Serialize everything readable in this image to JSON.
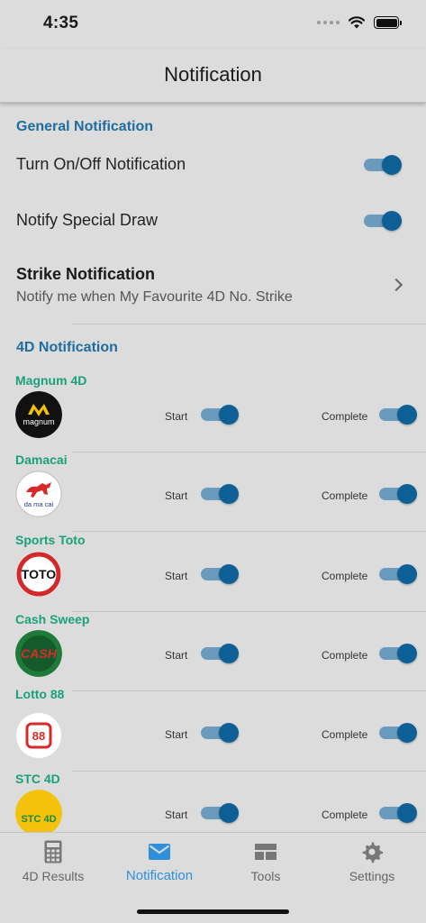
{
  "status_bar": {
    "time": "4:35"
  },
  "nav": {
    "title": "Notification"
  },
  "general": {
    "header": "General Notification",
    "turn_on_off": {
      "label": "Turn On/Off Notification",
      "enabled": true
    },
    "special_draw": {
      "label": "Notify Special Draw",
      "enabled": true
    },
    "strike": {
      "title": "Strike Notification",
      "subtitle": "Notify me when My Favourite 4D No. Strike"
    }
  },
  "fourd": {
    "header": "4D Notification",
    "start_label": "Start",
    "complete_label": "Complete",
    "providers": [
      {
        "name": "Magnum 4D",
        "logo": "magnum-logo",
        "logo_text": "magnum",
        "start": true,
        "complete": true
      },
      {
        "name": "Damacai",
        "logo": "damacai-logo",
        "logo_text": "da ma cai",
        "start": true,
        "complete": true
      },
      {
        "name": "Sports Toto",
        "logo": "sports-toto-logo",
        "logo_text": "TOTO",
        "start": true,
        "complete": true
      },
      {
        "name": "Cash Sweep",
        "logo": "cash-sweep-logo",
        "logo_text": "CASH",
        "start": true,
        "complete": true
      },
      {
        "name": "Lotto 88",
        "logo": "lotto-88-logo",
        "logo_text": "88",
        "start": true,
        "complete": true
      },
      {
        "name": "STC 4D",
        "logo": "stc-4d-logo",
        "logo_text": "STC 4D",
        "start": true,
        "complete": true
      }
    ]
  },
  "tabs": [
    {
      "label": "4D Results",
      "icon": "calculator-icon",
      "active": false
    },
    {
      "label": "Notification",
      "icon": "envelope-icon",
      "active": true
    },
    {
      "label": "Tools",
      "icon": "tools-icon",
      "active": false
    },
    {
      "label": "Settings",
      "icon": "gear-icon",
      "active": false
    }
  ],
  "colors": {
    "accent": "#1f6d9e",
    "provider_name": "#1aa07a",
    "toggle_knob": "#0f5f97",
    "toggle_track": "#6a9bbd",
    "tab_active": "#2f8fd8",
    "background": "#dcdcdc"
  }
}
